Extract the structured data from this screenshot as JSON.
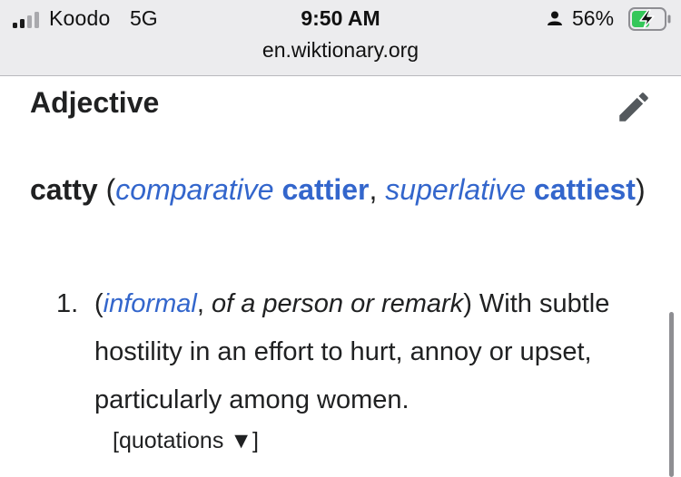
{
  "status_bar": {
    "carrier": "Koodo",
    "network": "5G",
    "time": "9:50 AM",
    "battery_percent": "56%",
    "signal_bars_filled": 2,
    "signal_bars_total": 4,
    "battery_level": 0.56,
    "battery_charging": true,
    "battery_color": "#34c759",
    "icons": [
      "signal-bars-icon",
      "person-icon",
      "battery-charging-icon"
    ]
  },
  "url_bar": {
    "url": "en.wiktionary.org"
  },
  "page": {
    "section_heading": "Adjective",
    "edit_icon": "pencil-icon",
    "headword": "catty",
    "open_paren": " (",
    "comparative_label": "comparative",
    "comparative_form": "cattier",
    "comma_sep": ", ",
    "superlative_label": "superlative",
    "superlative_form": "cattiest",
    "close_paren": ")",
    "link_color": "#3366cc",
    "definitions": [
      {
        "number": "1.",
        "open_paren": "(",
        "register_label": "informal",
        "qualifier_sep": ", ",
        "qualifier": "of a person or remark",
        "close_paren": ")",
        "text": " With subtle hostility in an effort to hurt, annoy or upset, particularly among women.",
        "quotations_toggle": "[quotations ▼]"
      }
    ]
  }
}
